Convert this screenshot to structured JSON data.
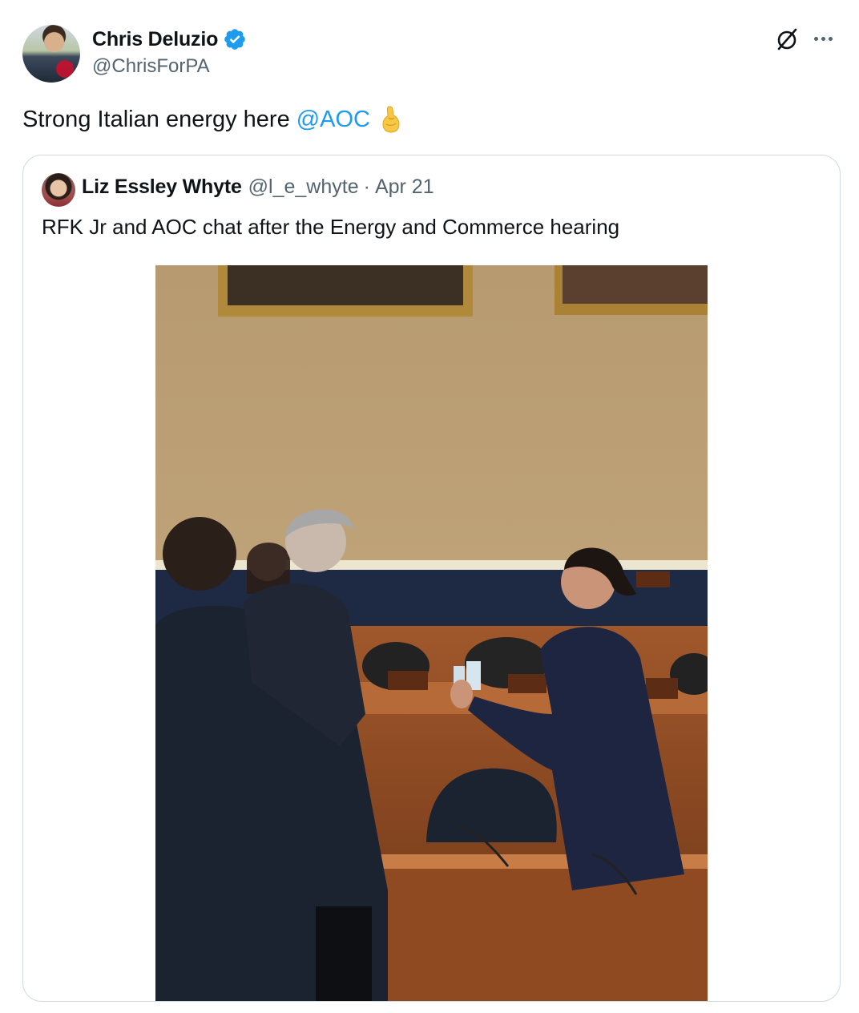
{
  "author": {
    "display_name": "Chris Deluzio",
    "handle": "@ChrisForPA",
    "verified": true,
    "avatar_icon": "profile-photo"
  },
  "tweet": {
    "text": "Strong Italian energy here",
    "mention": "@AOC",
    "emoji_icon": "pinched-fingers-emoji"
  },
  "toolbar": {
    "grok_icon": "grok-icon",
    "more_icon": "more-options-icon"
  },
  "quoted": {
    "display_name": "Liz Essley Whyte",
    "handle": "@l_e_whyte",
    "separator": "·",
    "date": "Apr 21",
    "text": "RFK Jr and AOC chat after the Energy and Commerce hearing",
    "media_icon": "photo-hearing-room"
  },
  "colors": {
    "accent": "#1d9bf0",
    "secondary_text": "#536471",
    "border": "#cfd9de",
    "verified_badge": "#1d9bf0"
  }
}
